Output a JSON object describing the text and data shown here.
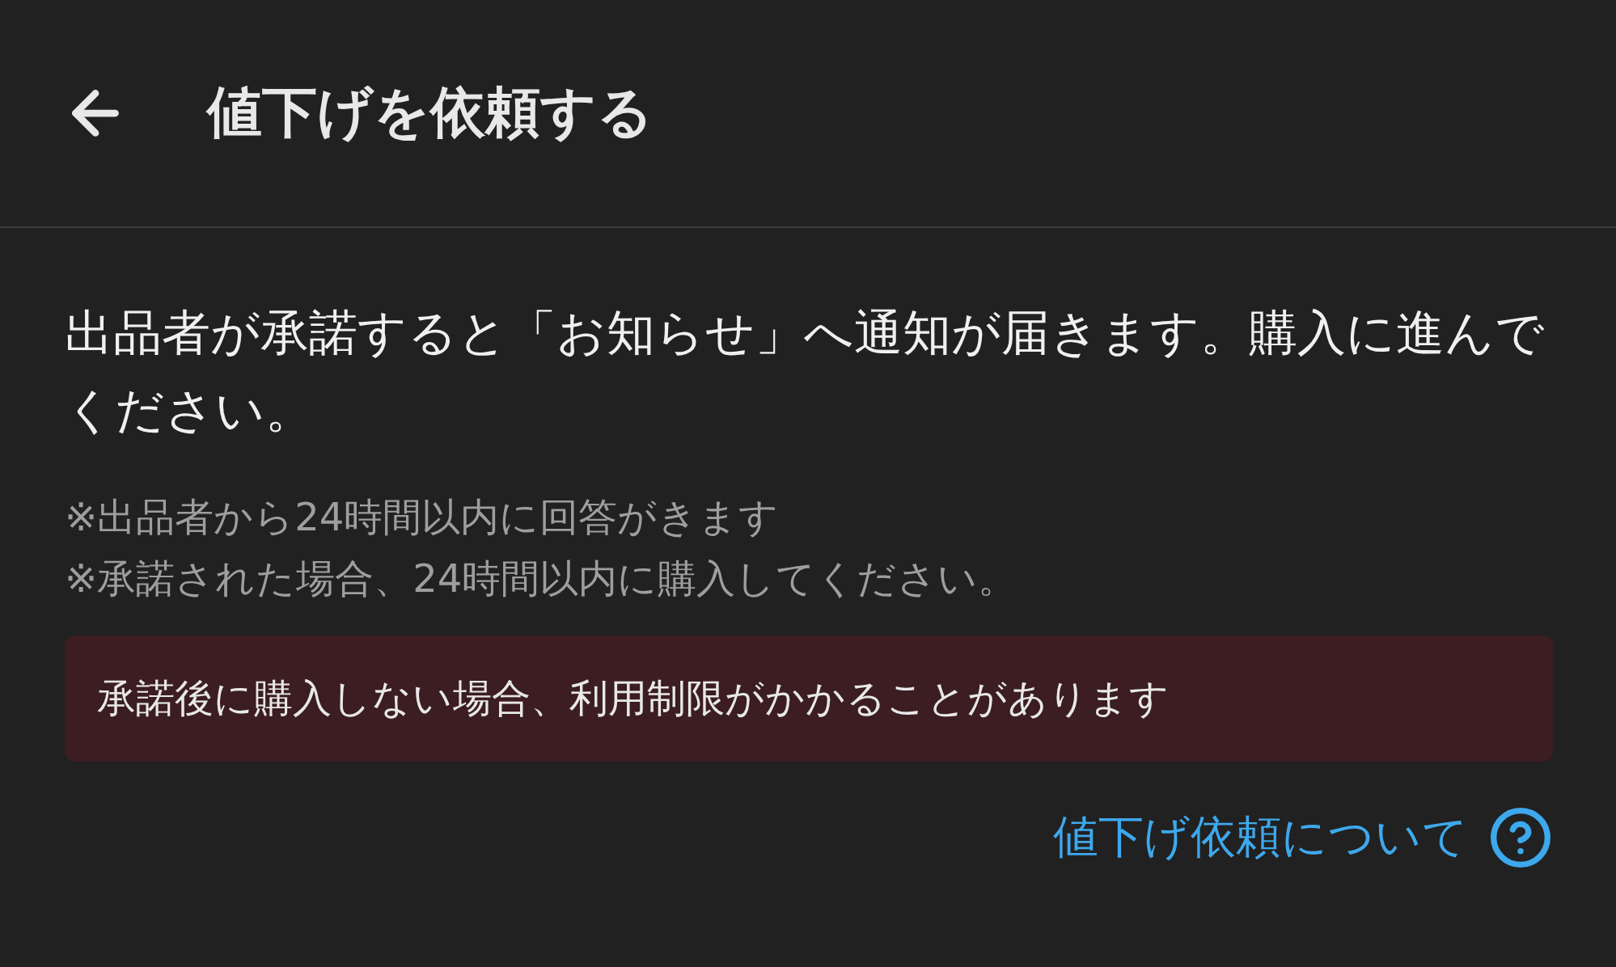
{
  "header": {
    "title": "値下げを依頼する"
  },
  "message": "出品者が承諾すると「お知らせ」へ通知が届きます。購入に進んでください。",
  "notes": [
    "※出品者から24時間以内に回答がきます",
    "※承諾された場合、24時間以内に購入してください。"
  ],
  "warning": "承諾後に購入しない場合、利用制限がかかることがあります",
  "help_link": "値下げ依頼について"
}
